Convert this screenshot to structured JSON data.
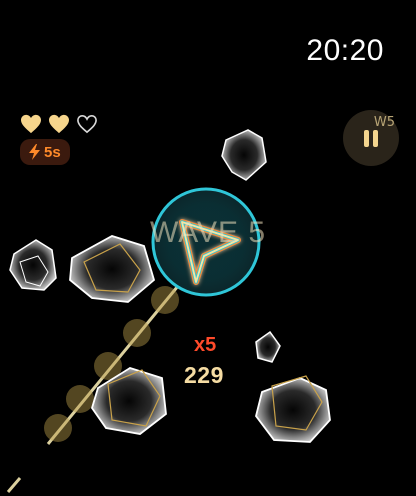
{
  "status_bar": {
    "time": "20:20"
  },
  "hud": {
    "lives": [
      {
        "state": "full"
      },
      {
        "state": "full"
      },
      {
        "state": "empty"
      }
    ],
    "boost_label": "5s",
    "pause_badge": "W5",
    "wave_banner": "WAVE 5",
    "combo": "x5",
    "score": "229"
  },
  "icons": {
    "heart": "heart-icon",
    "boost": "lightning-bolt-icon",
    "pause": "pause-icon",
    "ship": "arrow-ship-icon"
  },
  "colors": {
    "heart": "#f6d58c",
    "boost_text": "#ff8a2a",
    "boost_bg": "#3b1a0e",
    "ship_ring": "#2fc6d8",
    "ship": "#f7e6a3",
    "laser": "#f3e7b0",
    "combo": "#ff4a2a",
    "score": "#f5dca3",
    "asteroid_outline": "#ffffff",
    "asteroid_echo": "#c9a24a"
  }
}
